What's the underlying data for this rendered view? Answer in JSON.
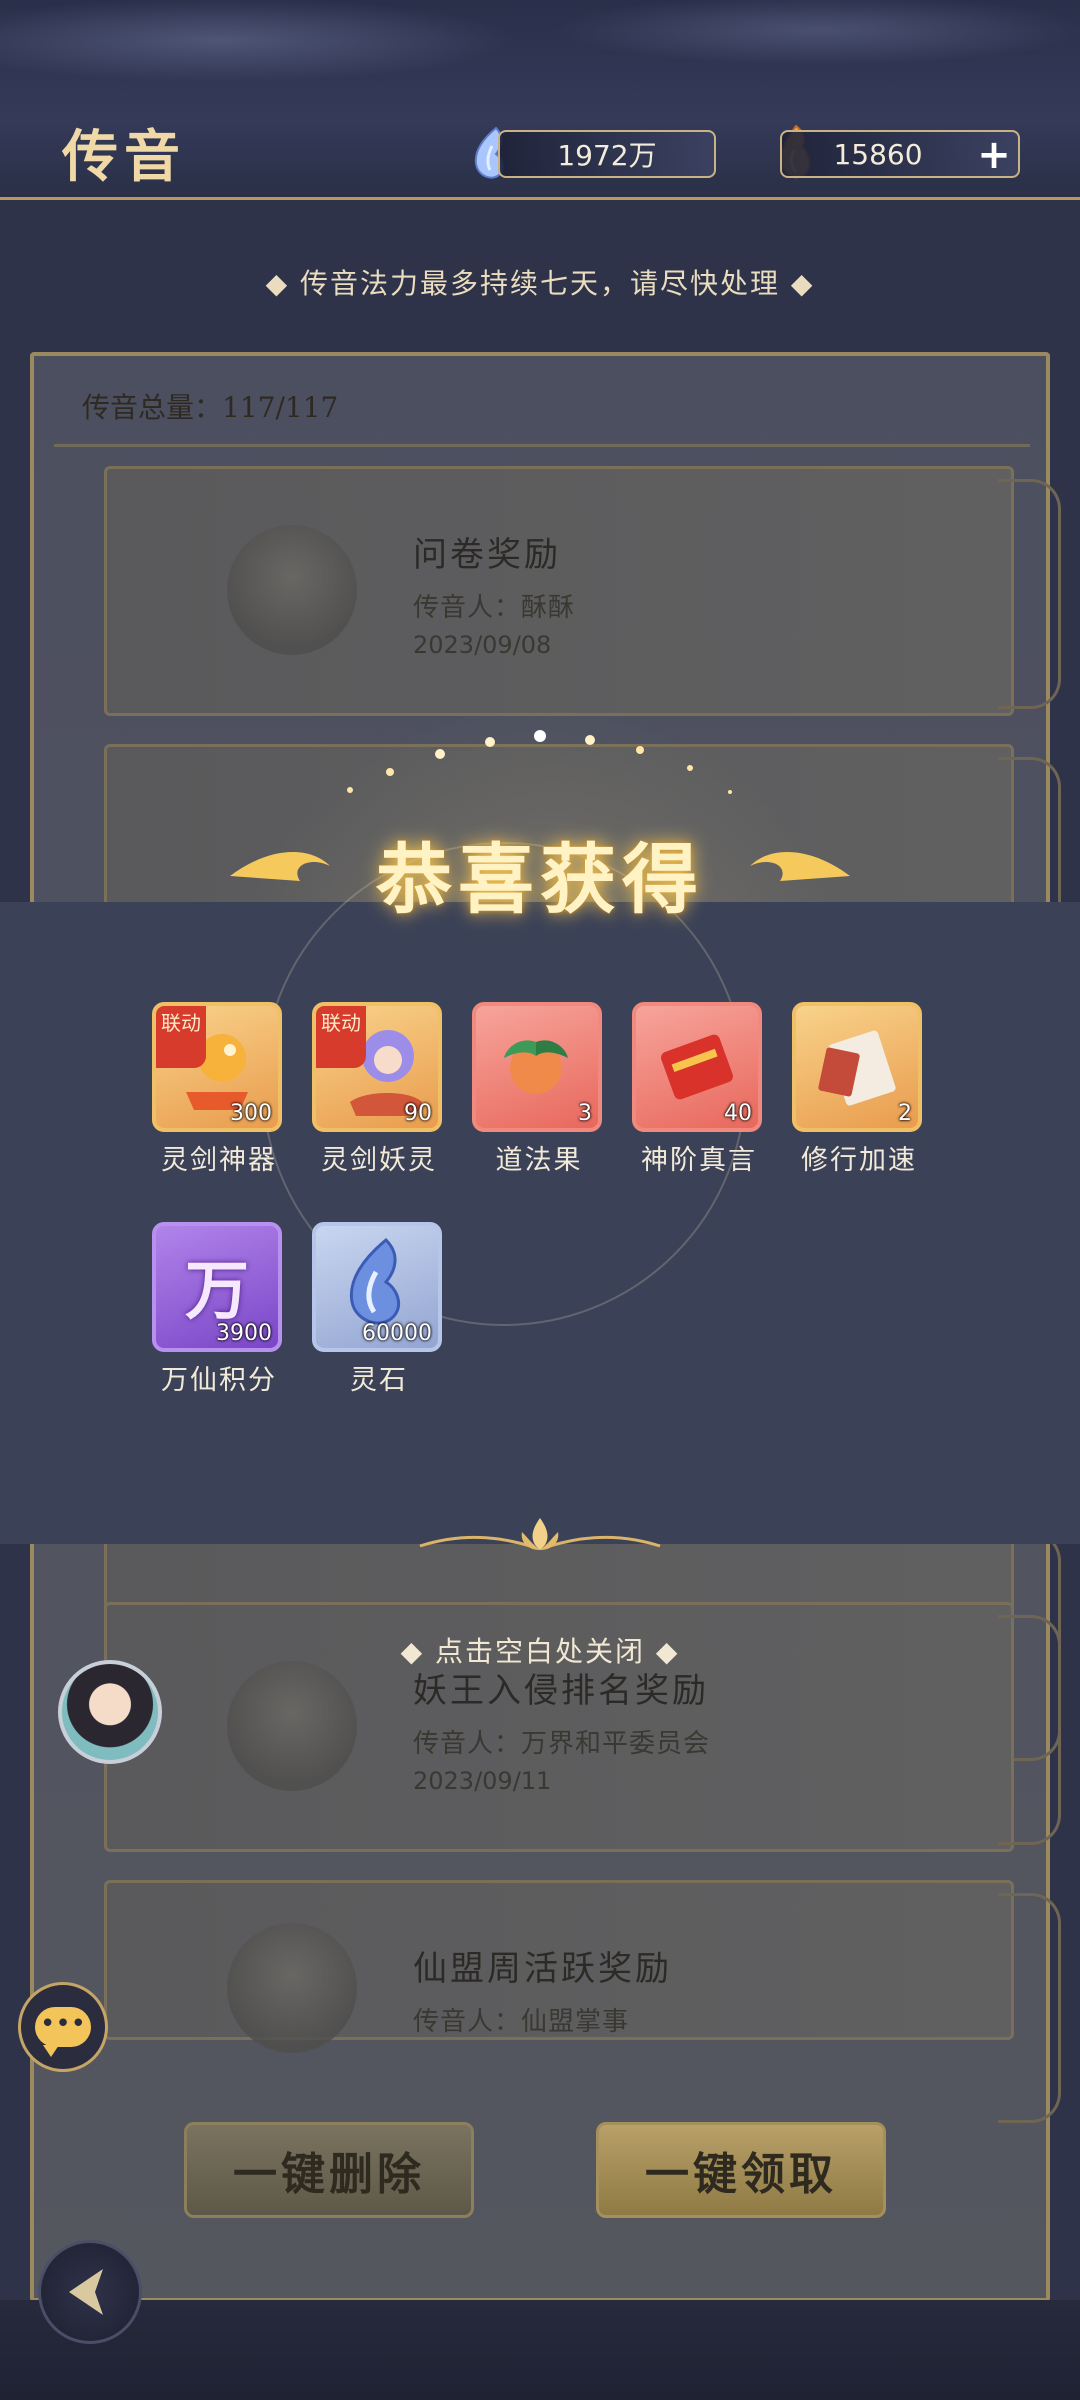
{
  "header": {
    "title": "传音",
    "jade_amount": "1972万",
    "fire_amount": "15860",
    "plus_label": "+"
  },
  "notice": "◆ 传音法力最多持续七天，请尽快处理 ◆",
  "panel": {
    "total_label": "传音总量：117/117"
  },
  "mails": [
    {
      "title": "问卷奖励",
      "sender": "传音人：酥酥",
      "date": "2023/09/08"
    },
    {
      "title": "妖王入侵排名奖励",
      "sender": "传音人：万界和平委员会",
      "date": "2023/09/11"
    },
    {
      "title": "仙盟周活跃奖励",
      "sender": "传音人：仙盟掌事",
      "date": ""
    }
  ],
  "reward_popup": {
    "banner": "恭喜获得",
    "close_hint": "◆ 点击空白处关闭 ◆",
    "link_badge": "联动",
    "items": [
      {
        "name": "灵剑神器",
        "qty": "300",
        "tile": "orange",
        "badge": true
      },
      {
        "name": "灵剑妖灵",
        "qty": "90",
        "tile": "orange",
        "badge": true
      },
      {
        "name": "道法果",
        "qty": "3",
        "tile": "red",
        "badge": false
      },
      {
        "name": "神阶真言",
        "qty": "40",
        "tile": "red",
        "badge": false
      },
      {
        "name": "修行加速",
        "qty": "2",
        "tile": "orange",
        "badge": false
      },
      {
        "name": "万仙积分",
        "qty": "3900",
        "tile": "purple",
        "badge": false,
        "glyph": "万"
      },
      {
        "name": "灵石",
        "qty": "60000",
        "tile": "blue",
        "badge": false
      }
    ]
  },
  "buttons": {
    "delete_all": "一键删除",
    "claim_all": "一键领取"
  },
  "chat": {
    "dots": "•••"
  },
  "colors": {
    "gold": "#f0d9a6",
    "overlay": "#3b4157",
    "badge_red": "#d63b2c"
  }
}
